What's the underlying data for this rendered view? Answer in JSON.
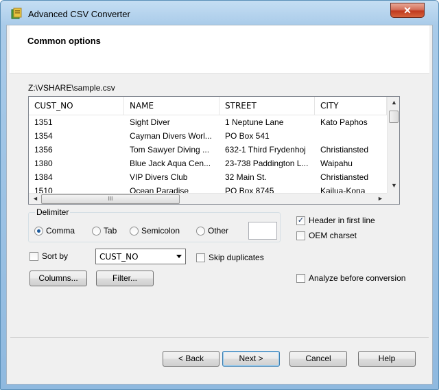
{
  "window": {
    "title": "Advanced CSV Converter",
    "close_glyph": "✕"
  },
  "header": {
    "title": "Common options"
  },
  "file_path": "Z:\\VSHARE\\sample.csv",
  "grid": {
    "columns": [
      "CUST_NO",
      "NAME",
      "STREET",
      "CITY"
    ],
    "rows": [
      [
        "1351",
        "Sight Diver",
        "1 Neptune Lane",
        "Kato Paphos"
      ],
      [
        "1354",
        "Cayman Divers Worl...",
        "PO Box 541",
        ""
      ],
      [
        "1356",
        "Tom Sawyer Diving ...",
        "632-1 Third Frydenhoj",
        "Christiansted"
      ],
      [
        "1380",
        "Blue Jack Aqua Cen...",
        "23-738 Paddington L...",
        "Waipahu"
      ],
      [
        "1384",
        "VIP Divers Club",
        "32 Main St.",
        "Christiansted"
      ],
      [
        "1510",
        "Ocean Paradise",
        "PO Box 8745",
        "Kailua-Kona"
      ]
    ],
    "hscroll_grip": "III",
    "arrows": {
      "up": "▲",
      "down": "▼",
      "left": "◄",
      "right": "►"
    }
  },
  "delimiter": {
    "label": "Delimiter",
    "options": [
      "Comma",
      "Tab",
      "Semicolon",
      "Other"
    ],
    "selected": "Comma",
    "other_value": ""
  },
  "options": {
    "header_first_line": {
      "label": "Header in first line",
      "checked": true,
      "mark": "✓"
    },
    "oem_charset": {
      "label": "OEM charset",
      "checked": false
    },
    "sort_by": {
      "label": "Sort by",
      "checked": false,
      "value": "CUST_NO"
    },
    "skip_duplicates": {
      "label": "Skip duplicates",
      "checked": false
    },
    "analyze": {
      "label": "Analyze before conversion",
      "checked": false
    }
  },
  "buttons": {
    "columns": "Columns...",
    "filter": "Filter...",
    "back": "< Back",
    "next": "Next >",
    "cancel": "Cancel",
    "help": "Help"
  }
}
